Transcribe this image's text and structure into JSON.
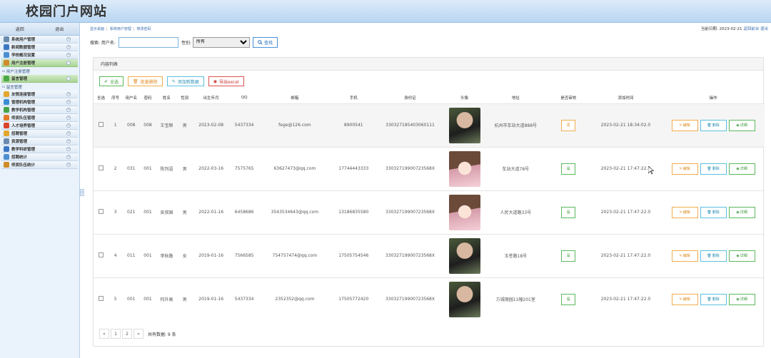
{
  "header": {
    "site_title": "校园门户网站"
  },
  "sidebar": {
    "top_buttons": [
      "返回",
      "退出"
    ],
    "menu": [
      {
        "label": "系统用户管理",
        "icon": "gear-icon",
        "color": "#6a8bb0"
      },
      {
        "label": "新闻数据管理",
        "icon": "monitor-icon",
        "color": "#3b78c4"
      },
      {
        "label": "学校概况设置",
        "icon": "calendar-icon",
        "color": "#4a8fd0"
      },
      {
        "label": "用户注册管理",
        "icon": "user-icon",
        "color": "#d08a2a",
        "active": true,
        "sub": "用户注册管理"
      },
      {
        "label": "留言管理",
        "icon": "message-icon",
        "color": "#4aa848",
        "active": true,
        "sub": "留言管理"
      },
      {
        "label": "友情连接管理",
        "icon": "folder-icon",
        "color": "#e3a72f"
      },
      {
        "label": "管理机构管理",
        "icon": "org-icon",
        "color": "#3c8ed4"
      },
      {
        "label": "教学机构管理",
        "icon": "image-icon",
        "color": "#46a34a"
      },
      {
        "label": "师资队伍管理",
        "icon": "team-icon",
        "color": "#e07b2a"
      },
      {
        "label": "人才培养管理",
        "icon": "talent-icon",
        "color": "#d9442e"
      },
      {
        "label": "招聘管理",
        "icon": "briefcase-icon",
        "color": "#e3a72f"
      },
      {
        "label": "资源管理",
        "icon": "gear-icon",
        "color": "#6a8bb0"
      },
      {
        "label": "教学科研管理",
        "icon": "monitor-icon",
        "color": "#3b78c4"
      },
      {
        "label": "招聘统计",
        "icon": "calendar-icon",
        "color": "#4a8fd0"
      },
      {
        "label": "师资队伍统计",
        "icon": "user-icon",
        "color": "#d08a2a"
      }
    ]
  },
  "breadcrumb": {
    "items": [
      "显示桌面",
      "系统用户管理",
      "修改密码"
    ]
  },
  "date_info": {
    "label": "当前日期: 2023-02-21",
    "link1": "返回前台",
    "link2": "退出"
  },
  "search": {
    "username_label": "搜索: 用户名:",
    "username_value": "",
    "gender_label": "性别:",
    "gender_value": "所有",
    "search_button": "查找"
  },
  "panel": {
    "title": "内容列表"
  },
  "toolbar": {
    "select_all": "全选",
    "batch_delete": "批量删除",
    "add_new": "添加新数据",
    "export": "导出excel"
  },
  "table": {
    "headers": [
      "全选",
      "序号",
      "用户名",
      "密码",
      "姓名",
      "性别",
      "出生年月",
      "QQ",
      "邮箱",
      "手机",
      "身份证",
      "头像",
      "地址",
      "是否审核",
      "添加时间",
      "操作"
    ],
    "rows": [
      {
        "no": "1",
        "username": "008",
        "password": "008",
        "name": "王宝顺",
        "gender": "男",
        "birth": "2023-02-08",
        "qq": "5437334",
        "email": "fege@126.com",
        "phone": "8900541",
        "idcard": "330327185403060111",
        "avatar": "avatar-photo",
        "address": "杭州市车站大道888号",
        "audit": "否",
        "audit_status": "no",
        "added": "2023-02-21 18:34:02.0"
      },
      {
        "no": "2",
        "username": "031",
        "password": "001",
        "name": "陈列语",
        "gender": "男",
        "birth": "2022-03-16",
        "qq": "7575765",
        "email": "63627473@qq.com",
        "phone": "17744443333",
        "idcard": "33032719900723568X",
        "avatar": "avatar-anime",
        "address": "车站大道78号",
        "audit": "是",
        "audit_status": "yes",
        "added": "2023-02-21 17:47:22.0"
      },
      {
        "no": "3",
        "username": "021",
        "password": "001",
        "name": "吴叔国",
        "gender": "男",
        "birth": "2022-01-16",
        "qq": "6458686",
        "email": "3543534643@qq.com",
        "phone": "13186835580",
        "idcard": "33032719900723568X",
        "avatar": "avatar-anime",
        "address": "人民大道路33号",
        "audit": "是",
        "audit_status": "yes",
        "added": "2023-02-21 17:47:22.0"
      },
      {
        "no": "4",
        "username": "011",
        "password": "001",
        "name": "李秋路",
        "gender": "女",
        "birth": "2019-01-16",
        "qq": "7566585",
        "email": "754757474@qq.com",
        "phone": "17505754546",
        "idcard": "33032719900723568X",
        "avatar": "avatar-photo",
        "address": "玉苍路18号",
        "audit": "是",
        "audit_status": "yes",
        "added": "2023-02-21 17:47:22.0"
      },
      {
        "no": "5",
        "username": "001",
        "password": "001",
        "name": "何升高",
        "gender": "男",
        "birth": "2019-01-16",
        "qq": "5437334",
        "email": "2352352@qq.com",
        "phone": "17505772420",
        "idcard": "33032719900723568X",
        "avatar": "avatar-photo",
        "address": "方城丽园11幢201室",
        "audit": "是",
        "audit_status": "yes",
        "added": "2023-02-21 17:47:22.0"
      }
    ],
    "ops": {
      "edit": "编辑",
      "delete": "删除",
      "detail": "详细"
    }
  },
  "pager": {
    "prev": "«",
    "pages": [
      "1",
      "2"
    ],
    "next": "»",
    "total": "共有数据: 9 条"
  }
}
